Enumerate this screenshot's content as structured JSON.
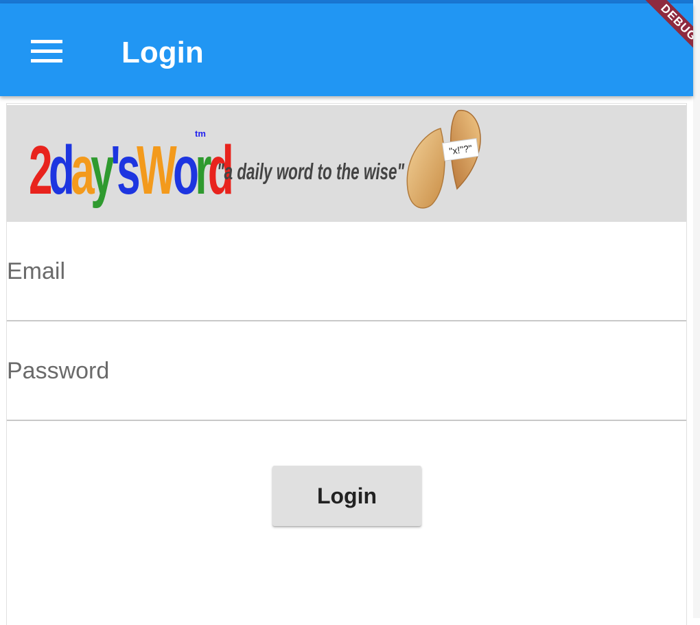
{
  "app_bar": {
    "title": "Login",
    "menu_icon": "hamburger-menu-icon",
    "color": "#2196f3"
  },
  "debug_banner": {
    "label": "DEBUG",
    "color": "#8e2a3f"
  },
  "banner": {
    "logo_text": "2days'Word",
    "logo_letters": [
      {
        "ch": "2",
        "color": "#e8231d"
      },
      {
        "ch": "d",
        "color": "#1d35e0"
      },
      {
        "ch": "a",
        "color": "#f39a1c"
      },
      {
        "ch": "y",
        "color": "#2f9a2f"
      },
      {
        "ch": "s",
        "color": "#1d35e0"
      },
      {
        "ch": "W",
        "color": "#f39a1c"
      },
      {
        "ch": "o",
        "color": "#1d35e0"
      },
      {
        "ch": "r",
        "color": "#2f9a2f"
      },
      {
        "ch": "d",
        "color": "#e8231d"
      }
    ],
    "trademark": "tm",
    "tagline": "\"a daily word to the wise\"",
    "cookie_slip_text": "\"x!\"?\"",
    "background": "#dddddd"
  },
  "form": {
    "email_placeholder": "Email",
    "email_value": "",
    "password_placeholder": "Password",
    "password_value": "",
    "login_label": "Login"
  }
}
